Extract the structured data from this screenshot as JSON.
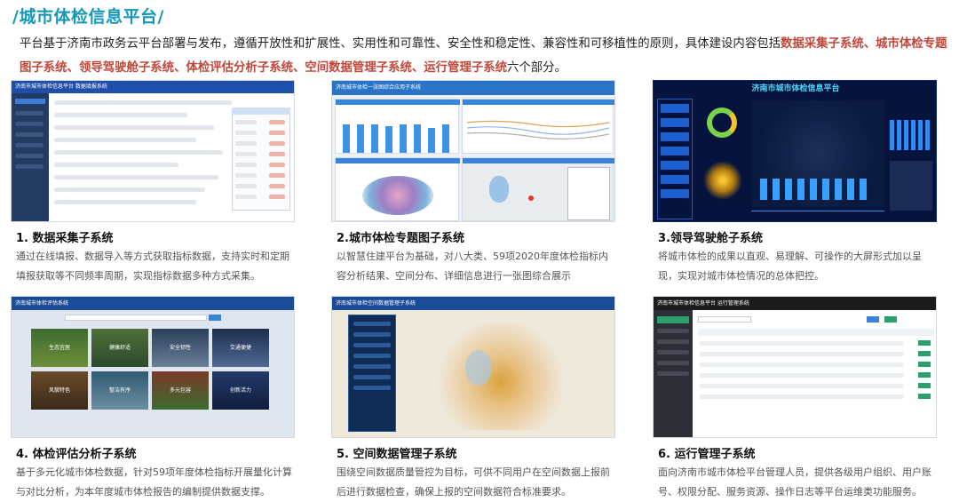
{
  "page": {
    "title": "/城市体检信息平台/",
    "intro_prefix": "平台基于济南市政务云平台部署与发布，遵循开放性和扩展性、实用性和可靠性、安全性和稳定性、兼容性和可移植性的原则，具体建设内容包括",
    "intro_highlight": "数据采集子系统、城市体检专题图子系统、领导驾驶舱子系统、体检评估分析子系统、空间数据管理子系统、运行管理子系统",
    "intro_suffix": "六个部分。"
  },
  "cards": [
    {
      "title": "1. 数据采集子系统",
      "desc": "通过在线填报、数据导入等方式获取指标数据，支持实时和定期填报获取等不同频率周期，实现指标数据多种方式采集。",
      "screen_title": "济南市城市体检信息平台 数据填报系统",
      "accent": "#1f4fa8"
    },
    {
      "title": "2.城市体检专题图子系统",
      "desc": "以智慧住建平台为基础，对八大类、59项2020年度体检指标内容分析结果、空间分布、详细信息进行一张图综合展示",
      "screen_title": "济南城市体检一张图综合应用子系统",
      "accent": "#2a74c8"
    },
    {
      "title": "3.领导驾驶舱子系统",
      "desc": "将城市体检的成果以直观、易理解、可操作的大屏形式加以呈现，实现对城市体检情况的总体把控。",
      "screen_title": "济南市城市体检信息平台",
      "accent": "#0a1a4a"
    },
    {
      "title": "4. 体检评估分析子系统",
      "desc": "基于多元化城市体检数据，针对59项年度体检指标开展量化计算与对比分析，为本年度城市体检报告的编制提供数据支撑。",
      "screen_title": "济南城市体检评估系统",
      "accent": "#1a4b96",
      "tiles": [
        "生态宜居",
        "健康舒适",
        "安全韧性",
        "交通便捷",
        "风貌特色",
        "整洁有序",
        "多元包容",
        "创新活力"
      ]
    },
    {
      "title": "5. 空间数据管理子系统",
      "desc": "围绕空间数据质量管控为目标，可供不同用户在空间数据上报前后进行数据检查，确保上报的空间数据符合标准要求。",
      "screen_title": "济南城市体检空间数据管理子系统",
      "accent": "#1a4b96"
    },
    {
      "title": "6. 运行管理子系统",
      "desc": "面向济南市城市体检平台管理人员，提供各级用户组织、用户账号、权限分配、服务资源、操作日志等平台运维类功能服务。",
      "screen_title": "济南市城市体检信息平台 运行管理系统",
      "accent": "#1b1b1b"
    }
  ]
}
